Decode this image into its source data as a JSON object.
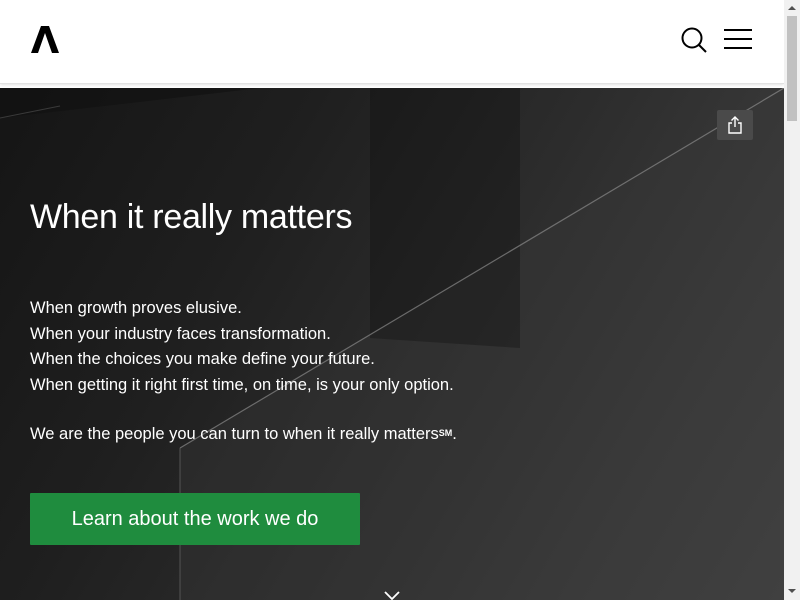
{
  "header": {
    "logo_alt": "Accenture",
    "icons": {
      "search": "search-icon",
      "menu": "hamburger-menu-icon"
    }
  },
  "hero": {
    "title": "When it really matters",
    "lines": [
      "When growth proves elusive.",
      "When your industry faces transformation.",
      "When the choices you make define your future.",
      "When getting it right first time, on time, is your only option."
    ],
    "tagline": "We are the people you can turn to when it really matters",
    "tagline_mark": "SM",
    "tagline_end": ".",
    "cta_label": "Learn about the work we do",
    "share_icon": "share-icon",
    "scroll_icon": "chevron-down-icon"
  },
  "colors": {
    "accent_green": "#1f8c3e",
    "hero_bg": "#222222",
    "header_bg": "#ffffff"
  }
}
